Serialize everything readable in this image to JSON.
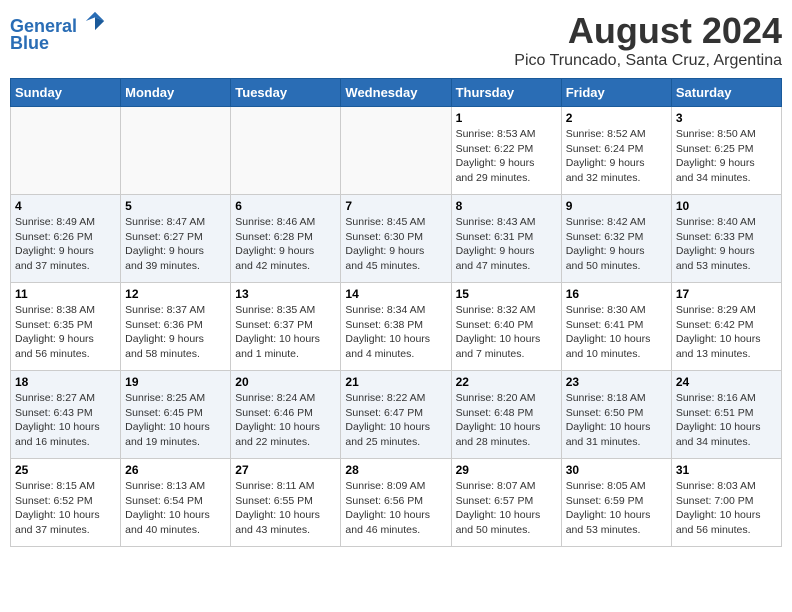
{
  "header": {
    "logo_line1": "General",
    "logo_line2": "Blue",
    "main_title": "August 2024",
    "subtitle": "Pico Truncado, Santa Cruz, Argentina"
  },
  "days_of_week": [
    "Sunday",
    "Monday",
    "Tuesday",
    "Wednesday",
    "Thursday",
    "Friday",
    "Saturday"
  ],
  "weeks": [
    [
      {
        "day": "",
        "content": ""
      },
      {
        "day": "",
        "content": ""
      },
      {
        "day": "",
        "content": ""
      },
      {
        "day": "",
        "content": ""
      },
      {
        "day": "1",
        "content": "Sunrise: 8:53 AM\nSunset: 6:22 PM\nDaylight: 9 hours\nand 29 minutes."
      },
      {
        "day": "2",
        "content": "Sunrise: 8:52 AM\nSunset: 6:24 PM\nDaylight: 9 hours\nand 32 minutes."
      },
      {
        "day": "3",
        "content": "Sunrise: 8:50 AM\nSunset: 6:25 PM\nDaylight: 9 hours\nand 34 minutes."
      }
    ],
    [
      {
        "day": "4",
        "content": "Sunrise: 8:49 AM\nSunset: 6:26 PM\nDaylight: 9 hours\nand 37 minutes."
      },
      {
        "day": "5",
        "content": "Sunrise: 8:47 AM\nSunset: 6:27 PM\nDaylight: 9 hours\nand 39 minutes."
      },
      {
        "day": "6",
        "content": "Sunrise: 8:46 AM\nSunset: 6:28 PM\nDaylight: 9 hours\nand 42 minutes."
      },
      {
        "day": "7",
        "content": "Sunrise: 8:45 AM\nSunset: 6:30 PM\nDaylight: 9 hours\nand 45 minutes."
      },
      {
        "day": "8",
        "content": "Sunrise: 8:43 AM\nSunset: 6:31 PM\nDaylight: 9 hours\nand 47 minutes."
      },
      {
        "day": "9",
        "content": "Sunrise: 8:42 AM\nSunset: 6:32 PM\nDaylight: 9 hours\nand 50 minutes."
      },
      {
        "day": "10",
        "content": "Sunrise: 8:40 AM\nSunset: 6:33 PM\nDaylight: 9 hours\nand 53 minutes."
      }
    ],
    [
      {
        "day": "11",
        "content": "Sunrise: 8:38 AM\nSunset: 6:35 PM\nDaylight: 9 hours\nand 56 minutes."
      },
      {
        "day": "12",
        "content": "Sunrise: 8:37 AM\nSunset: 6:36 PM\nDaylight: 9 hours\nand 58 minutes."
      },
      {
        "day": "13",
        "content": "Sunrise: 8:35 AM\nSunset: 6:37 PM\nDaylight: 10 hours\nand 1 minute."
      },
      {
        "day": "14",
        "content": "Sunrise: 8:34 AM\nSunset: 6:38 PM\nDaylight: 10 hours\nand 4 minutes."
      },
      {
        "day": "15",
        "content": "Sunrise: 8:32 AM\nSunset: 6:40 PM\nDaylight: 10 hours\nand 7 minutes."
      },
      {
        "day": "16",
        "content": "Sunrise: 8:30 AM\nSunset: 6:41 PM\nDaylight: 10 hours\nand 10 minutes."
      },
      {
        "day": "17",
        "content": "Sunrise: 8:29 AM\nSunset: 6:42 PM\nDaylight: 10 hours\nand 13 minutes."
      }
    ],
    [
      {
        "day": "18",
        "content": "Sunrise: 8:27 AM\nSunset: 6:43 PM\nDaylight: 10 hours\nand 16 minutes."
      },
      {
        "day": "19",
        "content": "Sunrise: 8:25 AM\nSunset: 6:45 PM\nDaylight: 10 hours\nand 19 minutes."
      },
      {
        "day": "20",
        "content": "Sunrise: 8:24 AM\nSunset: 6:46 PM\nDaylight: 10 hours\nand 22 minutes."
      },
      {
        "day": "21",
        "content": "Sunrise: 8:22 AM\nSunset: 6:47 PM\nDaylight: 10 hours\nand 25 minutes."
      },
      {
        "day": "22",
        "content": "Sunrise: 8:20 AM\nSunset: 6:48 PM\nDaylight: 10 hours\nand 28 minutes."
      },
      {
        "day": "23",
        "content": "Sunrise: 8:18 AM\nSunset: 6:50 PM\nDaylight: 10 hours\nand 31 minutes."
      },
      {
        "day": "24",
        "content": "Sunrise: 8:16 AM\nSunset: 6:51 PM\nDaylight: 10 hours\nand 34 minutes."
      }
    ],
    [
      {
        "day": "25",
        "content": "Sunrise: 8:15 AM\nSunset: 6:52 PM\nDaylight: 10 hours\nand 37 minutes."
      },
      {
        "day": "26",
        "content": "Sunrise: 8:13 AM\nSunset: 6:54 PM\nDaylight: 10 hours\nand 40 minutes."
      },
      {
        "day": "27",
        "content": "Sunrise: 8:11 AM\nSunset: 6:55 PM\nDaylight: 10 hours\nand 43 minutes."
      },
      {
        "day": "28",
        "content": "Sunrise: 8:09 AM\nSunset: 6:56 PM\nDaylight: 10 hours\nand 46 minutes."
      },
      {
        "day": "29",
        "content": "Sunrise: 8:07 AM\nSunset: 6:57 PM\nDaylight: 10 hours\nand 50 minutes."
      },
      {
        "day": "30",
        "content": "Sunrise: 8:05 AM\nSunset: 6:59 PM\nDaylight: 10 hours\nand 53 minutes."
      },
      {
        "day": "31",
        "content": "Sunrise: 8:03 AM\nSunset: 7:00 PM\nDaylight: 10 hours\nand 56 minutes."
      }
    ]
  ]
}
